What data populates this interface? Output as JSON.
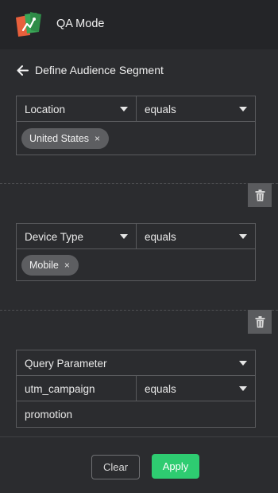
{
  "app": {
    "title": "QA Mode",
    "logo": "qa-mode-logo"
  },
  "header": {
    "back_icon": "arrow-left-icon",
    "title": "Define Audience Segment"
  },
  "conditions": [
    {
      "field": "Location",
      "operator": "equals",
      "values": [
        "United States"
      ]
    },
    {
      "field": "Device Type",
      "operator": "equals",
      "values": [
        "Mobile"
      ]
    },
    {
      "field": "Query Parameter",
      "param_key": "utm_campaign",
      "operator": "equals",
      "value": "promotion"
    }
  ],
  "chip_remove_glyph": "×",
  "delete_icon": "trash-icon",
  "footer": {
    "clear_label": "Clear",
    "apply_label": "Apply"
  },
  "colors": {
    "accent": "#2ecc71",
    "header_bg": "#242528",
    "body_bg": "#2b2c2f",
    "chip_bg": "#5d5e61"
  }
}
